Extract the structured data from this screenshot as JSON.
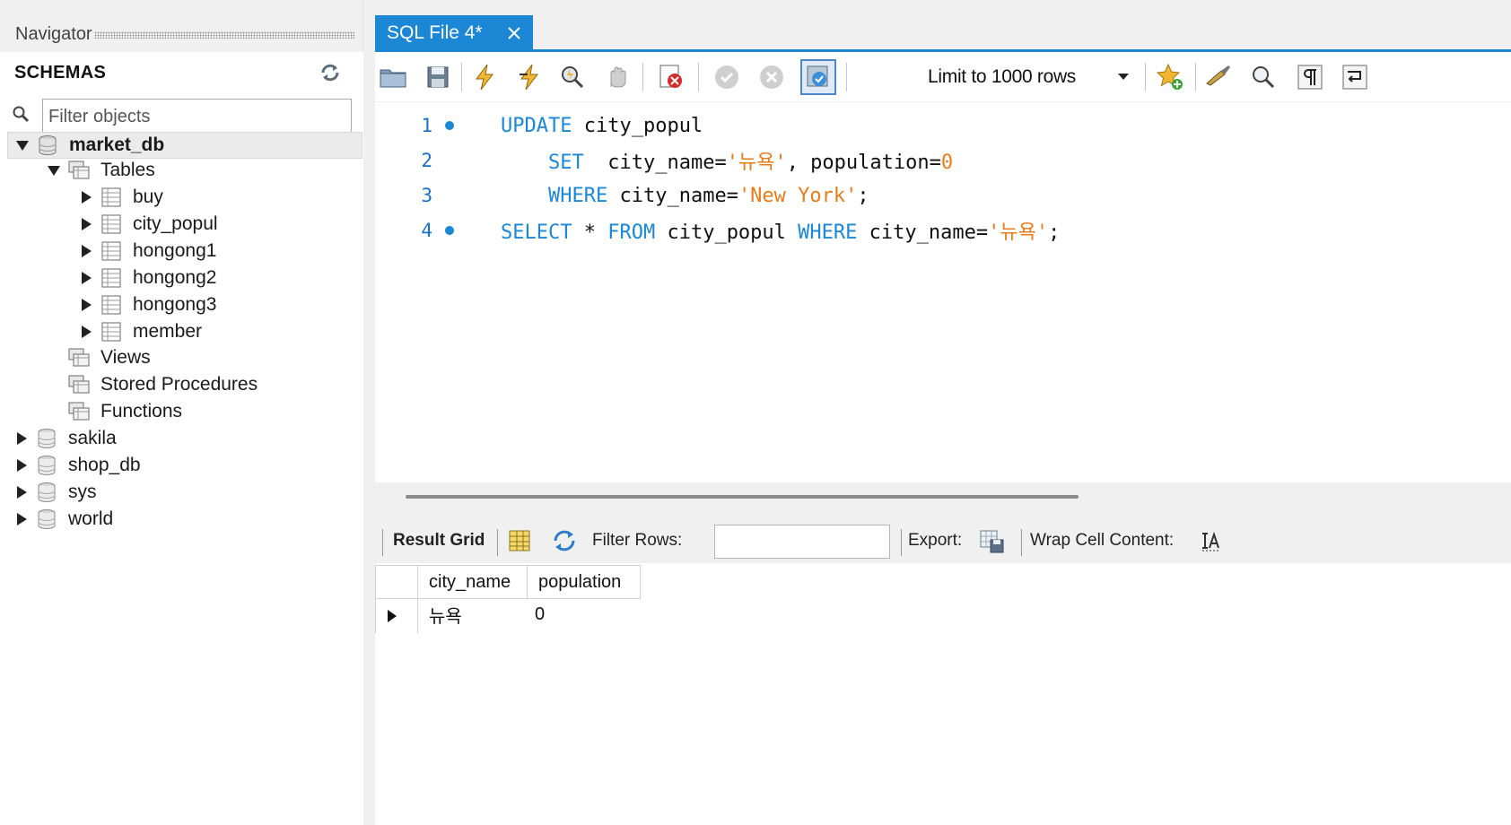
{
  "navigator": {
    "title": "Navigator",
    "schemas_title": "SCHEMAS",
    "filter_placeholder": "Filter objects",
    "tree": {
      "market_db": "market_db",
      "tables_label": "Tables",
      "tables": [
        "buy",
        "city_popul",
        "hongong1",
        "hongong2",
        "hongong3",
        "member"
      ],
      "views": "Views",
      "stored_procedures": "Stored Procedures",
      "functions": "Functions",
      "other_schemas": [
        "sakila",
        "shop_db",
        "sys",
        "world"
      ]
    }
  },
  "editor": {
    "tab_title": "SQL File 4*",
    "limit_select": "Limit to 1000 rows",
    "lines": [
      {
        "num": "1",
        "has_dot": true
      },
      {
        "num": "2",
        "has_dot": false
      },
      {
        "num": "3",
        "has_dot": false
      },
      {
        "num": "4",
        "has_dot": true
      }
    ],
    "code": {
      "l1_kw": "UPDATE",
      "l1_rest": " city_popul",
      "l2_kw": "SET",
      "l2_a": "  city_name=",
      "l2_str": "'뉴욕'",
      "l2_b": ", population=",
      "l2_num": "0",
      "l3_kw": "WHERE",
      "l3_a": " city_name=",
      "l3_str": "'New York'",
      "l3_b": ";",
      "l4_kw1": "SELECT",
      "l4_a": " * ",
      "l4_kw2": "FROM",
      "l4_b": " city_popul ",
      "l4_kw3": "WHERE",
      "l4_c": " city_name=",
      "l4_str": "'뉴욕'",
      "l4_d": ";"
    }
  },
  "result": {
    "result_grid_label": "Result Grid",
    "filter_rows_label": "Filter Rows:",
    "export_label": "Export:",
    "wrap_label": "Wrap Cell Content:",
    "columns": [
      "city_name",
      "population"
    ],
    "rows": [
      [
        "뉴욕",
        "0"
      ]
    ]
  },
  "colors": {
    "accent": "#1c87d4",
    "string": "#e67c1c"
  },
  "icons": [
    "refresh-icon",
    "search-icon",
    "database-icon",
    "table-icon",
    "folder-icon",
    "open-file-icon",
    "save-icon",
    "execute-icon",
    "execute-current-icon",
    "explain-icon",
    "stop-icon",
    "toggle-error-icon",
    "commit-icon",
    "rollback-icon",
    "autocommit-icon",
    "bookmark-icon",
    "beautify-icon",
    "find-icon",
    "invisible-chars-icon",
    "wrap-icon",
    "grid-icon",
    "refresh-rows-icon",
    "export-icon",
    "wrap-cell-icon"
  ]
}
